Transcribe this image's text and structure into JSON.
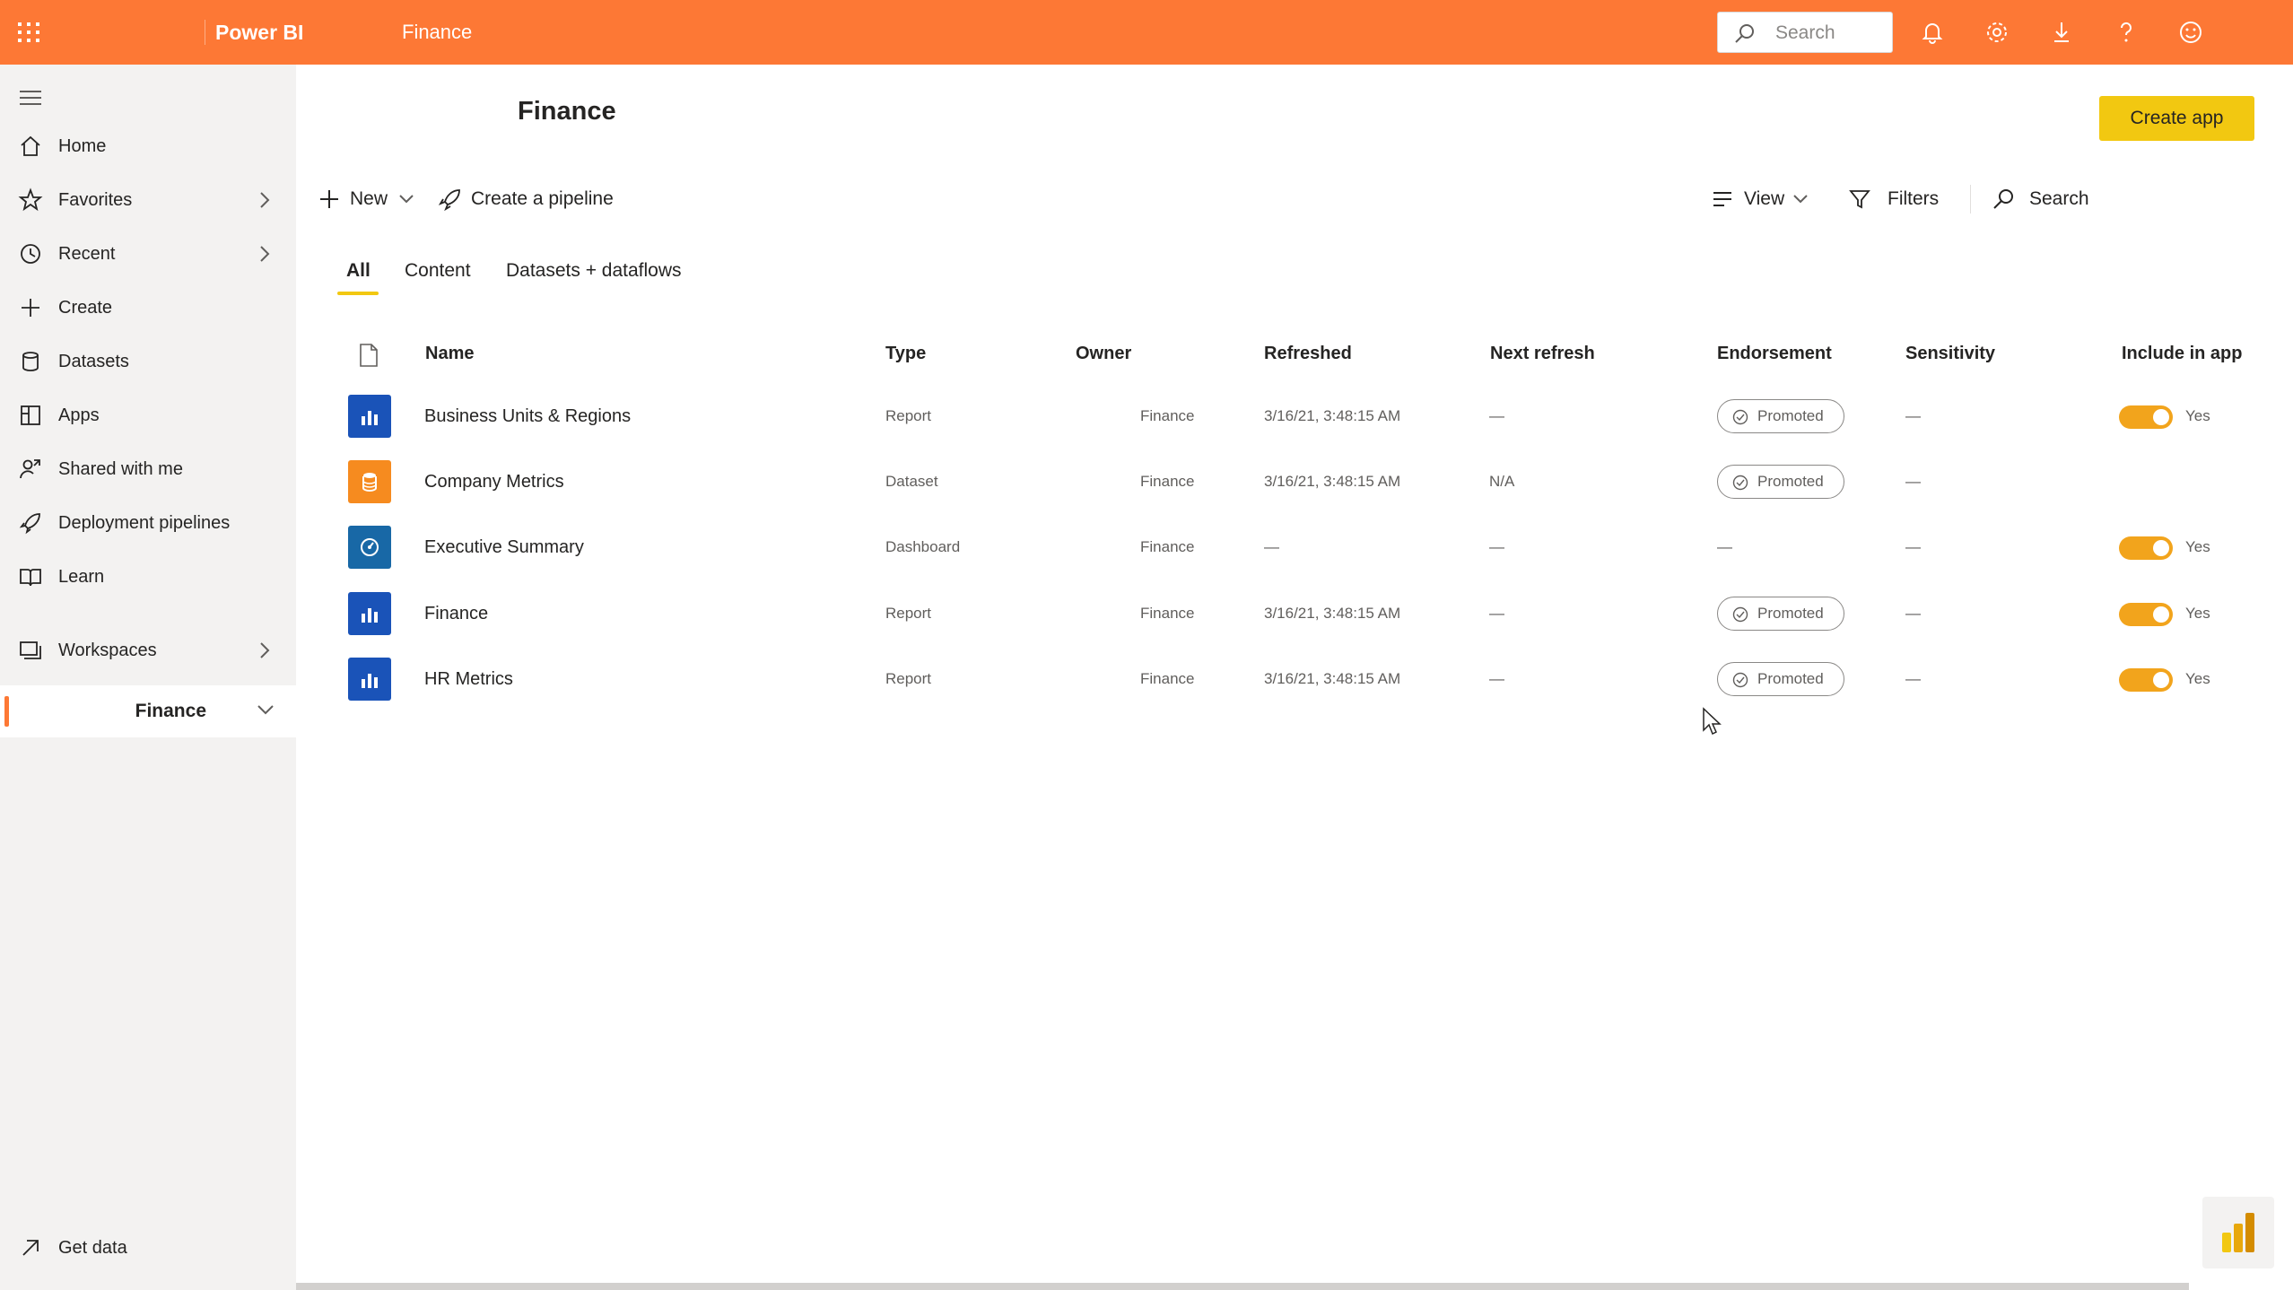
{
  "topbar": {
    "brand": "Power BI",
    "breadcrumb": "Finance",
    "search_placeholder": "Search",
    "background": "#fd7835"
  },
  "sidebar": {
    "items": [
      {
        "label": "Home",
        "icon": "home-icon"
      },
      {
        "label": "Favorites",
        "icon": "star-icon"
      },
      {
        "label": "Recent",
        "icon": "clock-icon"
      },
      {
        "label": "Create",
        "icon": "plus-icon"
      },
      {
        "label": "Datasets",
        "icon": "database-icon"
      },
      {
        "label": "Apps",
        "icon": "apps-icon"
      },
      {
        "label": "Shared with me",
        "icon": "shared-icon"
      },
      {
        "label": "Deployment pipelines",
        "icon": "rocket-icon"
      },
      {
        "label": "Learn",
        "icon": "book-icon"
      },
      {
        "label": "Workspaces",
        "icon": "workspaces-icon"
      }
    ],
    "active_workspace": "Finance",
    "get_data": "Get data"
  },
  "main": {
    "title": "Finance",
    "create_app": "Create app",
    "toolbar": {
      "new": "New",
      "create_pipeline": "Create a pipeline",
      "view": "View",
      "filters": "Filters",
      "search": "Search"
    },
    "tabs": [
      "All",
      "Content",
      "Datasets + dataflows"
    ],
    "active_tab": "All",
    "columns": [
      "Name",
      "Type",
      "Owner",
      "Refreshed",
      "Next refresh",
      "Endorsement",
      "Sensitivity",
      "Include in app"
    ],
    "rows": [
      {
        "name": "Business Units & Regions",
        "type": "Report",
        "owner": "Finance",
        "refreshed": "3/16/21, 3:48:15 AM",
        "next_refresh": "—",
        "endorsement": "Promoted",
        "sensitivity": "—",
        "include": "Yes",
        "icon": "report-icon",
        "color": "#1a53b8"
      },
      {
        "name": "Company Metrics",
        "type": "Dataset",
        "owner": "Finance",
        "refreshed": "3/16/21, 3:48:15 AM",
        "next_refresh": "N/A",
        "endorsement": "Promoted",
        "sensitivity": "—",
        "include": "",
        "icon": "dataset-icon",
        "color": "#f68b1f"
      },
      {
        "name": "Executive Summary",
        "type": "Dashboard",
        "owner": "Finance",
        "refreshed": "—",
        "next_refresh": "—",
        "endorsement": "—",
        "sensitivity": "—",
        "include": "Yes",
        "icon": "dashboard-icon",
        "color": "#1868a6"
      },
      {
        "name": "Finance",
        "type": "Report",
        "owner": "Finance",
        "refreshed": "3/16/21, 3:48:15 AM",
        "next_refresh": "—",
        "endorsement": "Promoted",
        "sensitivity": "—",
        "include": "Yes",
        "icon": "report-icon",
        "color": "#1a53b8"
      },
      {
        "name": "HR Metrics",
        "type": "Report",
        "owner": "Finance",
        "refreshed": "3/16/21, 3:48:15 AM",
        "next_refresh": "—",
        "endorsement": "Promoted",
        "sensitivity": "—",
        "include": "Yes",
        "icon": "report-icon",
        "color": "#1a53b8"
      }
    ]
  }
}
